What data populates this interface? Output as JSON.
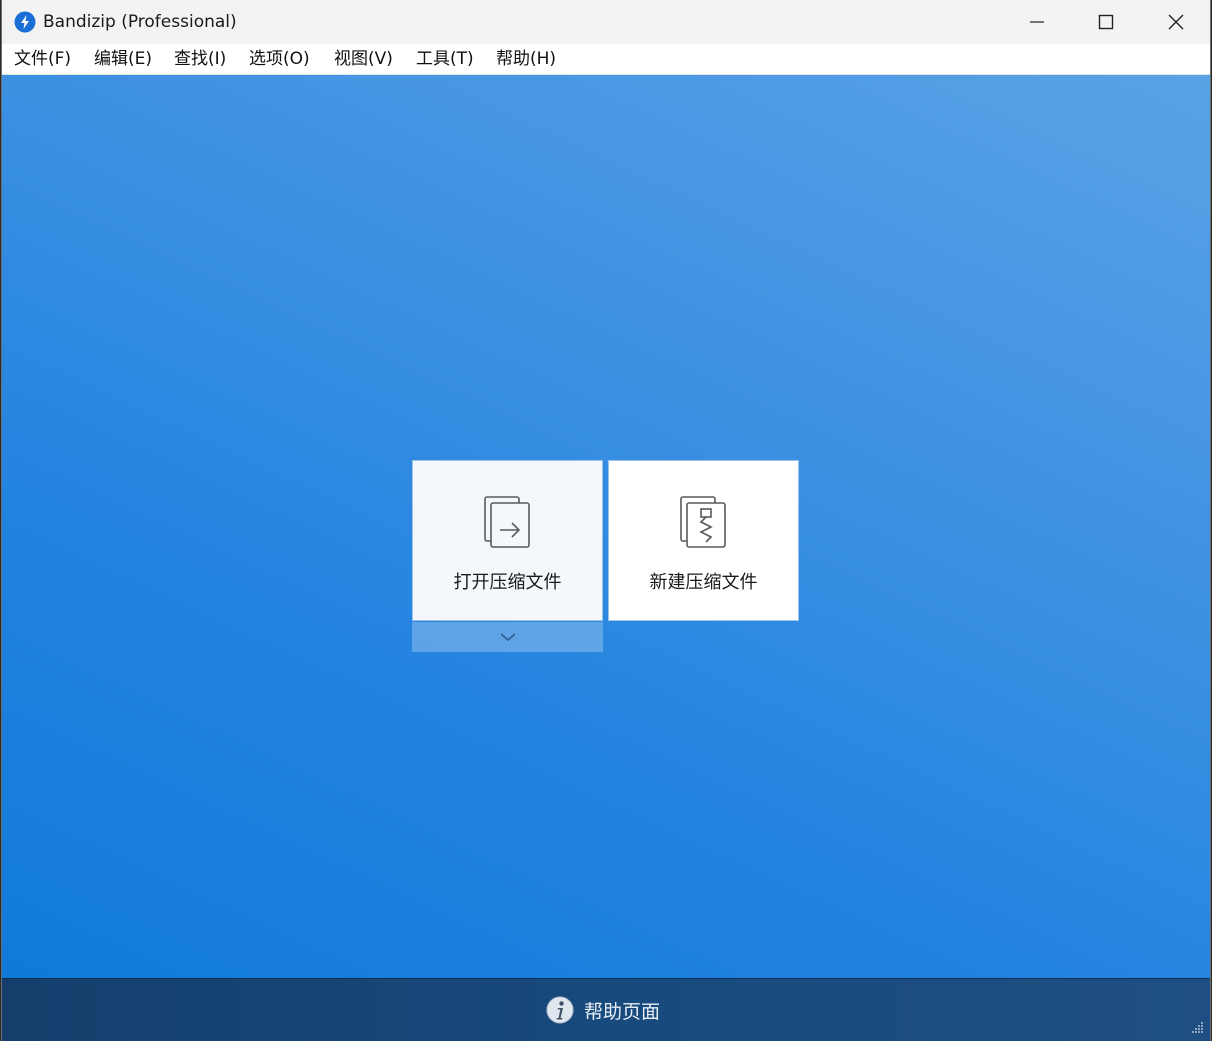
{
  "window": {
    "title": "Bandizip (Professional)"
  },
  "menu": [
    "文件(F)",
    "编辑(E)",
    "查找(I)",
    "选项(O)",
    "视图(V)",
    "工具(T)",
    "帮助(H)"
  ],
  "tiles": {
    "open_label": "打开压缩文件",
    "new_label": "新建压缩文件"
  },
  "footer": {
    "help_label": "帮助页面"
  },
  "icons": {
    "app": "bandizip-logo-icon",
    "minimize": "minimize-icon",
    "maximize": "maximize-icon",
    "close": "close-icon",
    "open": "open-archive-icon",
    "new": "new-archive-icon",
    "dropdown": "chevron-down-icon",
    "help": "info-icon"
  },
  "colors": {
    "accent": "#1a7fdc",
    "footer": "#184a7d"
  }
}
